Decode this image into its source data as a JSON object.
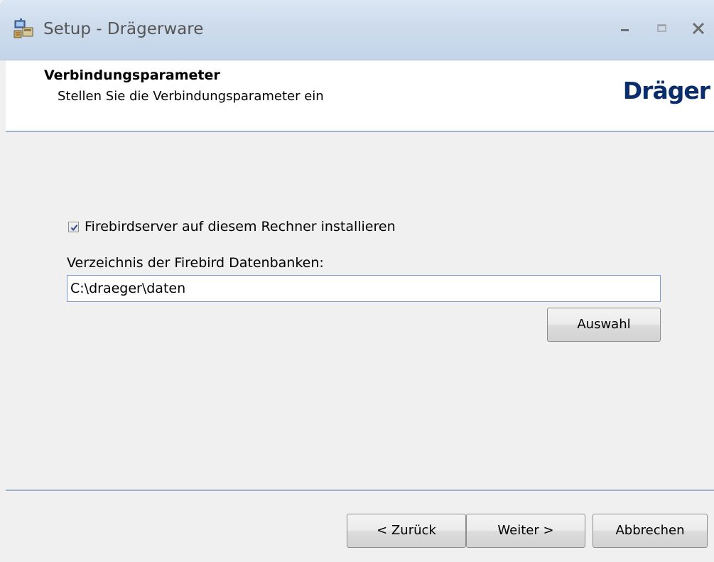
{
  "window": {
    "title": "Setup - Drägerware",
    "controls": {
      "minimize": "_",
      "maximize": "□",
      "close": "X"
    }
  },
  "header": {
    "title": "Verbindungsparameter",
    "subtitle": "Stellen Sie die Verbindungsparameter ein",
    "logo": "Dräger"
  },
  "form": {
    "install_checkbox": {
      "label": "Firebirdserver auf diesem Rechner installieren",
      "checked": true
    },
    "directory": {
      "label": "Verzeichnis der Firebird Datenbanken:",
      "value": "C:\\draeger\\daten"
    },
    "select_button": "Auswahl"
  },
  "footer": {
    "back_label": "< Zurück",
    "next_label": "Weiter >",
    "cancel_label": "Abbrechen"
  },
  "icons": {
    "app": "setup-computer-icon",
    "checkmark": "checkmark-icon"
  },
  "colors": {
    "titlebar": "#cddbec",
    "header_bg": "#ffffff",
    "separator": "#9fb3cb",
    "logo": "#0a2d6b",
    "input_border": "#7a9cd3"
  }
}
